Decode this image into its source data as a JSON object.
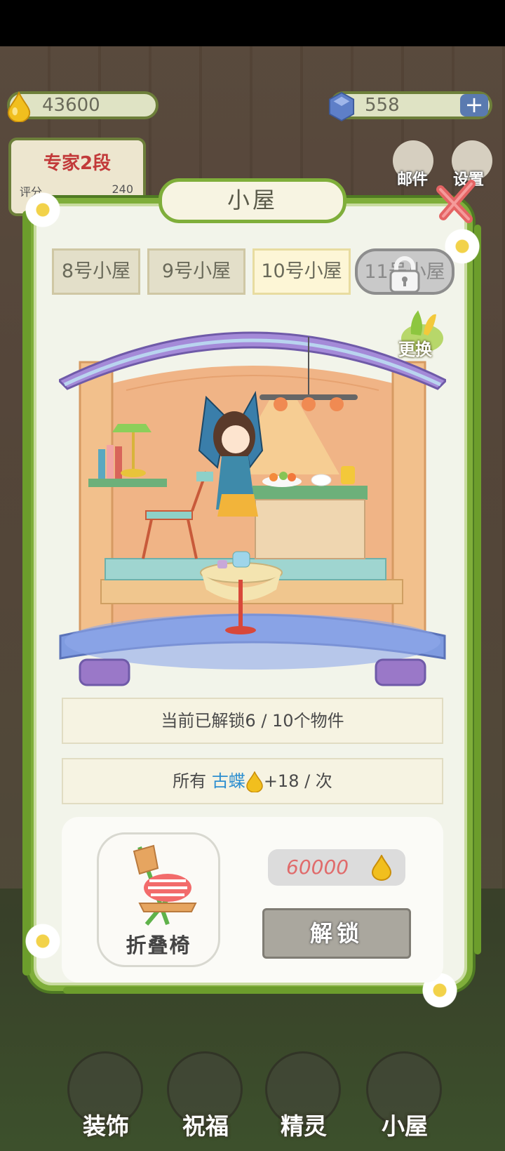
{
  "hud": {
    "honey": "43600",
    "gems": "558",
    "plus_glyph": "+",
    "rank_title": "专家2段",
    "rank_label": "评分",
    "rank_value": "240",
    "mail_label": "邮件",
    "settings_label": "设置"
  },
  "dialog": {
    "title": "小屋",
    "close_glyph": "✕",
    "tabs": [
      {
        "label": "8号小屋",
        "state": "normal"
      },
      {
        "label": "9号小屋",
        "state": "normal"
      },
      {
        "label": "10号小屋",
        "state": "selected"
      },
      {
        "label": "11号小屋",
        "state": "locked"
      }
    ],
    "swap_label": "更换",
    "unlocked_text": "当前已解锁6 / 10个物件",
    "bonus_prefix": "所有",
    "bonus_target": "古蝶",
    "bonus_suffix": "+18 / 次",
    "item_name": "折叠椅",
    "price": "60000",
    "unlock_label": "解锁"
  },
  "nav": [
    {
      "label": "装饰"
    },
    {
      "label": "祝福"
    },
    {
      "label": "精灵"
    },
    {
      "label": "小屋"
    }
  ],
  "colors": {
    "vine_green": "#7fae3a",
    "roof_purple": "#a48ad8",
    "floor_blue": "#7f9be0",
    "highlight_blue": "#2e8fd0",
    "price_red": "#e06b6b"
  },
  "icons": [
    "honey-drop-icon",
    "gem-icon",
    "plus-icon",
    "mail-icon",
    "settings-gear-icon",
    "close-x-icon",
    "lock-icon",
    "swap-icon",
    "folding-chair-icon"
  ]
}
